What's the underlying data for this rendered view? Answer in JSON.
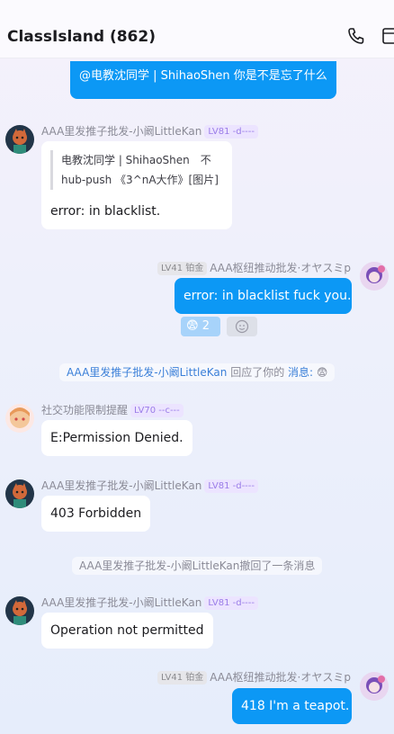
{
  "header": {
    "title": "ClassIsland (862)",
    "icons": [
      "phone-icon",
      "more-icon"
    ]
  },
  "messages": {
    "m0": {
      "text": "@电教沈同学 | ShihaoShen 你是不是忘了什么"
    },
    "m1": {
      "name": "AAA里发推子批发-小阚LittleKan",
      "level": "LV81 -d----",
      "quote_line1": "电教沈同学 | ShihaoShen　不",
      "quote_line2": "hub-push 《3^nA大作》[图片]",
      "text": "error: in blacklist."
    },
    "m2": {
      "level": "LV41 铂金",
      "name": "AAA枢纽推动批发·オヤスミp",
      "text": "error: in blacklist fuck you.",
      "reactions": [
        {
          "emoji": "😨",
          "count": "2"
        }
      ]
    },
    "sys1": {
      "actor": "AAA里发推子批发-小阚LittleKan",
      "action": " 回应了你的 ",
      "target": "消息:",
      "emoji": "😨"
    },
    "m3": {
      "name": "社交功能限制提醒",
      "level": "LV70 --c---",
      "text": "E:Permission Denied."
    },
    "m4": {
      "name": "AAA里发推子批发-小阚LittleKan",
      "level": "LV81 -d----",
      "text": "403 Forbidden"
    },
    "sys2": {
      "text": "AAA里发推子批发-小阚LittleKan撤回了一条消息"
    },
    "m5": {
      "name": "AAA里发推子批发-小阚LittleKan",
      "level": "LV81 -d----",
      "text": "Operation not permitted"
    },
    "m6": {
      "level": "LV41 铂金",
      "name": "AAA枢纽推动批发·オヤスミp",
      "text": "418 I'm a teapot."
    }
  },
  "colors": {
    "accent": "#0c98f5",
    "level_badge": "#9a7ce8",
    "link": "#3a7fd8"
  }
}
